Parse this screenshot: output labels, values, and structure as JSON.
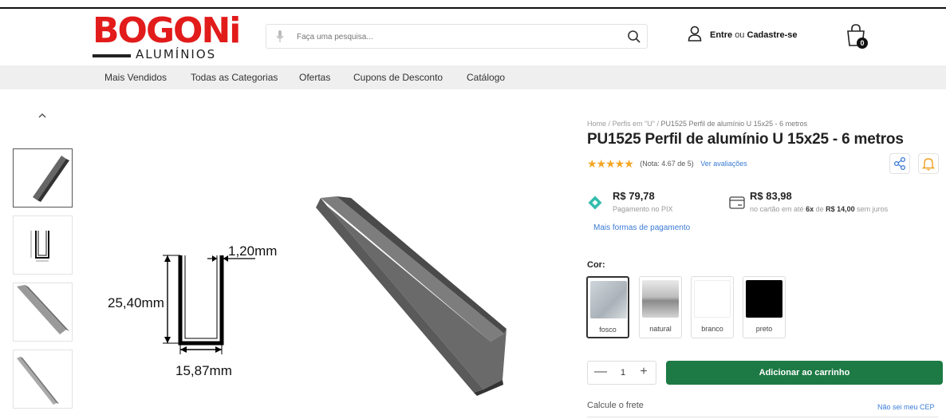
{
  "brand": {
    "name": "BOGONi",
    "subtitle": "ALUMÍNIOS",
    "color": "#e21b1b"
  },
  "search": {
    "placeholder": "Faça uma pesquisa..."
  },
  "account": {
    "login_label": "Entre",
    "or_label": "ou",
    "register_label": "Cadastre-se"
  },
  "cart": {
    "count": "0"
  },
  "nav": {
    "items": [
      "Mais Vendidos",
      "Todas as Categorias",
      "Ofertas",
      "Cupons de Desconto",
      "Catálogo"
    ]
  },
  "breadcrumb": {
    "home": "Home",
    "category": "Perfis em \"U\"",
    "current": "PU1525 Perfil de alumínio U 15x25 - 6 metros",
    "separator": "/"
  },
  "product": {
    "title": "PU1525 Perfil de alumínio U 15x25 - 6 metros",
    "rating": 4.67,
    "rating_text": "(Nota: 4.67 de 5)",
    "reviews_link": "Ver avaliações",
    "stars": "★★★★★"
  },
  "diagram": {
    "thickness": "1,20mm",
    "height": "25,40mm",
    "width": "15,87mm"
  },
  "pricing": {
    "pix_price": "R$ 79,78",
    "pix_label": "Pagamento no PIX",
    "card_price": "R$ 83,98",
    "card_prefix": "no cartão em até",
    "card_installments": "6x",
    "card_of": "de",
    "card_installment_value": "R$ 14,00",
    "card_suffix": "sem juros",
    "more_payment": "Mais formas de pagamento",
    "pix_color": "#32bcad"
  },
  "color_option": {
    "label": "Cor:",
    "options": [
      {
        "name": "fosco",
        "selected": true
      },
      {
        "name": "natural",
        "selected": false
      },
      {
        "name": "branco",
        "selected": false
      },
      {
        "name": "preto",
        "selected": false
      }
    ]
  },
  "purchase": {
    "quantity": "1",
    "minus": "—",
    "plus": "+",
    "add_to_cart": "Adicionar ao carrinho",
    "button_color": "#1d7a45"
  },
  "shipping": {
    "label": "Calcule o frete",
    "unknown_cep": "Não sei meu CEP"
  },
  "icons": {
    "mic": "microphone-icon",
    "search": "search-icon",
    "user": "user-icon",
    "bag": "shopping-bag-icon",
    "share": "share-icon",
    "bell": "bell-icon",
    "pix": "pix-icon",
    "card": "credit-card-icon",
    "up": "chevron-up-icon"
  }
}
